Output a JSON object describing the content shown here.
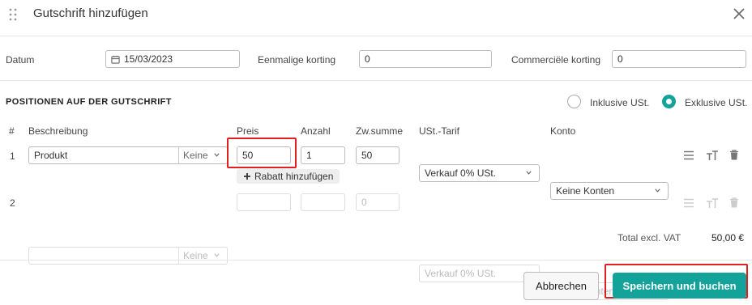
{
  "dialog": {
    "title": "Gutschrift hinzufügen"
  },
  "meta": {
    "date_label": "Datum",
    "date_value": "15/03/2023",
    "one_time_discount_label": "Eenmalige korting",
    "one_time_discount_value": "0",
    "commercial_discount_label": "Commerciële korting",
    "commercial_discount_value": "0"
  },
  "positions": {
    "section_title": "POSITIONEN AUF DER GUTSCHRIFT",
    "vat_mode_options": [
      "Inklusive USt.",
      "Exklusive USt."
    ],
    "vat_mode_selected": "Exklusive USt.",
    "columns": [
      "#",
      "Beschreibung",
      "Preis",
      "Anzahl",
      "Zw.summe",
      "USt.-Tarif",
      "Konto"
    ],
    "rows": [
      {
        "index": "1",
        "description": "Produkt",
        "unit": "Keine",
        "price": "50",
        "quantity": "1",
        "subtotal": "50",
        "vat_rate": "Verkauf 0% USt.",
        "account": "Keine Konten",
        "add_discount_label": "Rabatt hinzufügen"
      },
      {
        "index": "2",
        "description": "",
        "unit": "Keine",
        "price": "",
        "quantity": "",
        "subtotal": "0",
        "vat_rate": "Verkauf 0% USt.",
        "account": "Keine Konten"
      }
    ],
    "total_label": "Total excl. VAT",
    "total_value": "50,00 €"
  },
  "footer": {
    "cancel_label": "Abbrechen",
    "save_label": "Speichern und buchen"
  },
  "colors": {
    "accent": "#14a39a",
    "highlight": "#e02020"
  }
}
